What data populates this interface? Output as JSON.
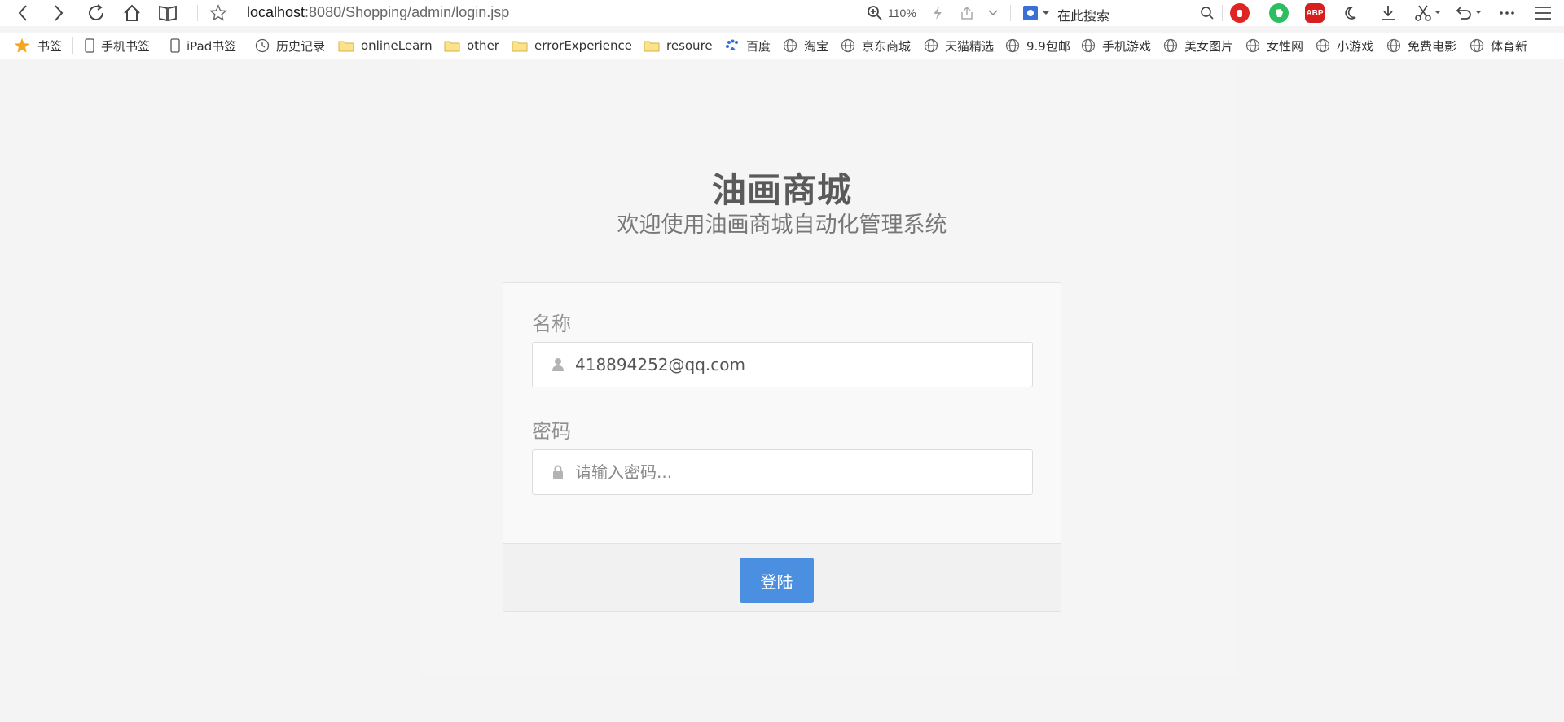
{
  "browser": {
    "url_host": "localhost",
    "url_path": ":8080/Shopping/admin/login.jsp",
    "zoom": "110%",
    "search_placeholder": "在此搜索",
    "extensions": {
      "abp_label": "ABP"
    }
  },
  "bookmarks": [
    {
      "label": "书签",
      "icon": "star-icon"
    },
    {
      "label": "手机书签",
      "icon": "phone-icon"
    },
    {
      "label": "iPad书签",
      "icon": "tablet-icon"
    },
    {
      "label": "历史记录",
      "icon": "clock-icon"
    },
    {
      "label": "onlineLearn",
      "icon": "folder-icon"
    },
    {
      "label": "other",
      "icon": "folder-icon"
    },
    {
      "label": "errorExperience",
      "icon": "folder-icon"
    },
    {
      "label": "resoure",
      "icon": "folder-icon"
    },
    {
      "label": "百度",
      "icon": "baidu-icon"
    },
    {
      "label": "淘宝",
      "icon": "globe-icon"
    },
    {
      "label": "京东商城",
      "icon": "globe-icon"
    },
    {
      "label": "天猫精选",
      "icon": "globe-icon"
    },
    {
      "label": "9.9包邮",
      "icon": "globe-icon"
    },
    {
      "label": "手机游戏",
      "icon": "globe-icon"
    },
    {
      "label": "美女图片",
      "icon": "globe-icon"
    },
    {
      "label": "女性网",
      "icon": "globe-icon"
    },
    {
      "label": "小游戏",
      "icon": "globe-icon"
    },
    {
      "label": "免费电影",
      "icon": "globe-icon"
    },
    {
      "label": "体育新",
      "icon": "globe-icon"
    }
  ],
  "login": {
    "title": "油画商城",
    "subtitle": "欢迎使用油画商城自动化管理系统",
    "name_label": "名称",
    "name_value": "418894252@qq.com",
    "password_label": "密码",
    "password_placeholder": "请输入密码...",
    "submit_label": "登陆"
  },
  "colors": {
    "accent": "#4a8fe0",
    "page_bg": "#f4f4f4",
    "title": "#5a5a5a"
  }
}
